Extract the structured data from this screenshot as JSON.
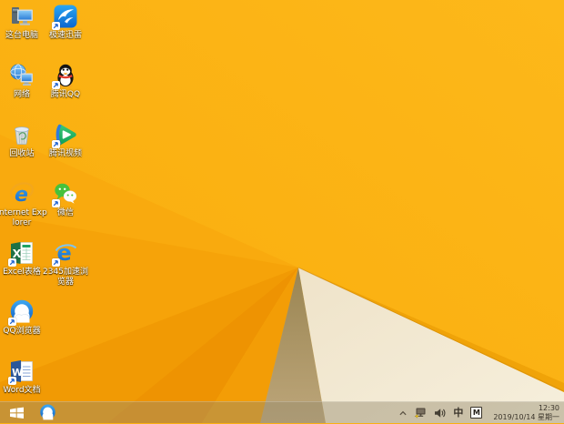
{
  "desktop": {
    "icons": [
      {
        "name": "this-pc",
        "label": "这台电脑",
        "shortcut": false
      },
      {
        "name": "thunder",
        "label": "极速迅雷",
        "shortcut": true
      },
      {
        "name": "network",
        "label": "网络",
        "shortcut": false
      },
      {
        "name": "tencent-qq",
        "label": "腾讯QQ",
        "shortcut": true
      },
      {
        "name": "recycle-bin",
        "label": "回收站",
        "shortcut": false
      },
      {
        "name": "tencent-video",
        "label": "腾讯视频",
        "shortcut": true
      },
      {
        "name": "internet-explorer",
        "label": "Internet Explorer",
        "shortcut": false
      },
      {
        "name": "wechat",
        "label": "微信",
        "shortcut": true
      },
      {
        "name": "excel",
        "label": "Excel表格",
        "shortcut": true
      },
      {
        "name": "2345-browser",
        "label": "2345加速浏览器",
        "shortcut": true
      },
      {
        "name": "qq-browser",
        "label": "QQ浏览器",
        "shortcut": true
      },
      {
        "name": "word",
        "label": "Word文档",
        "shortcut": true
      }
    ]
  },
  "taskbar": {
    "start": {
      "name": "start-button"
    },
    "pinned": [
      {
        "name": "qq-browser"
      }
    ],
    "tray_icons": [
      {
        "name": "show-hidden-icons-chevron"
      },
      {
        "name": "network-warning-icon"
      },
      {
        "name": "volume-icon"
      },
      {
        "name": "ime-mode-indicator",
        "text": "中"
      },
      {
        "name": "ime-badge",
        "text": "M"
      }
    ],
    "clock": {
      "time": "12:30",
      "date": "2019/10/14 星期一"
    }
  },
  "colors": {
    "wallpaper_amber": "#FCB30F",
    "wallpaper_orange_dark": "#EE9302",
    "wallpaper_khaki": "#AF9663",
    "wallpaper_cream": "#F2E8D0",
    "ridge_amber": "#F0A308",
    "taskbar_tint": "rgba(150,140,110,0.45)",
    "label_text": "#FFFFFF",
    "tray_text": "#3A342B"
  }
}
